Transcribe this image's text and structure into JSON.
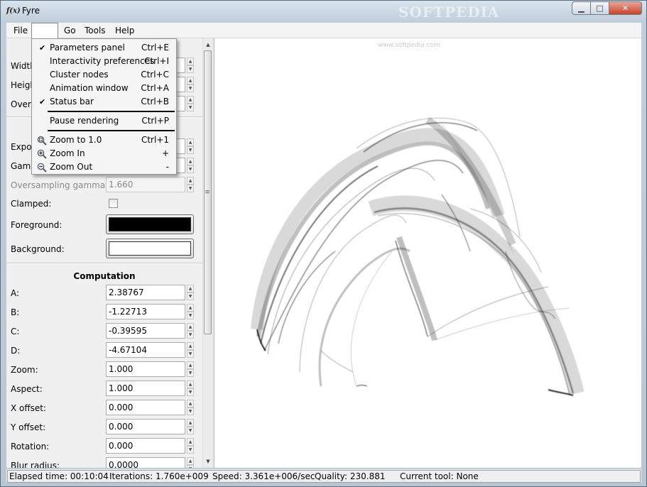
{
  "window": {
    "app_icon": "fyre-icon",
    "title": "Fyre",
    "watermark": "SOFTPEDIA",
    "controls": {
      "minimize": "minimize-icon",
      "maximize": "maximize-icon",
      "close": "close-icon"
    }
  },
  "menubar": {
    "items": [
      {
        "label": "File"
      },
      {
        "label": ""
      },
      {
        "label": "Go"
      },
      {
        "label": "Tools"
      },
      {
        "label": "Help"
      }
    ]
  },
  "view_menu": {
    "items": [
      {
        "label": "Parameters panel",
        "shortcut": "Ctrl+E",
        "checked": true
      },
      {
        "label": "Interactivity preferences",
        "shortcut": "Ctrl+I",
        "checked": false
      },
      {
        "label": "Cluster nodes",
        "shortcut": "Ctrl+C",
        "checked": false
      },
      {
        "label": "Animation window",
        "shortcut": "Ctrl+A",
        "checked": false
      },
      {
        "label": "Status bar",
        "shortcut": "Ctrl+B",
        "checked": true
      },
      {
        "label": "Pause rendering",
        "shortcut": "Ctrl+P",
        "checked": false
      },
      {
        "label": "Zoom to 1.0",
        "shortcut": "Ctrl+1",
        "icon": "zoom-reset-icon"
      },
      {
        "label": "Zoom In",
        "shortcut": "+",
        "icon": "zoom-in-icon"
      },
      {
        "label": "Zoom Out",
        "shortcut": "-",
        "icon": "zoom-out-icon"
      }
    ],
    "check_glyph": "✔"
  },
  "panel": {
    "render_rows": [
      {
        "label": "Width:",
        "value": ""
      },
      {
        "label": "Height:",
        "value": ""
      },
      {
        "label": "Oversample:",
        "value": ""
      },
      {
        "label": "Exposure:",
        "value": ""
      },
      {
        "label": "Gamma:",
        "value": ""
      }
    ],
    "oversampling_gamma": {
      "label": "Oversampling gamma:",
      "value": "1.660"
    },
    "clamped": {
      "label": "Clamped:",
      "checked": false
    },
    "foreground": {
      "label": "Foreground:",
      "color": "#000000"
    },
    "background": {
      "label": "Background:",
      "color": "#ffffff"
    },
    "computation_title": "Computation",
    "computation": [
      {
        "label": "A:",
        "value": "2.38767"
      },
      {
        "label": "B:",
        "value": "-1.22713"
      },
      {
        "label": "C:",
        "value": "-0.39595"
      },
      {
        "label": "D:",
        "value": "-4.67104"
      },
      {
        "label": "Zoom:",
        "value": "1.000"
      },
      {
        "label": "Aspect:",
        "value": "1.000"
      },
      {
        "label": "X offset:",
        "value": "0.000"
      },
      {
        "label": "Y offset:",
        "value": "0.000"
      },
      {
        "label": "Rotation:",
        "value": "0.000"
      },
      {
        "label": "Blur radius:",
        "value": "0.0000"
      }
    ]
  },
  "canvas": {
    "watermark": "www.softpedia.com"
  },
  "status": {
    "elapsed": "Elapsed time: 00:10:04",
    "iterations": "Iterations: 1.760e+009",
    "speed": "Speed: 3.361e+006/sec",
    "quality": "Quality: 230.881",
    "tool": "Current tool: None"
  }
}
